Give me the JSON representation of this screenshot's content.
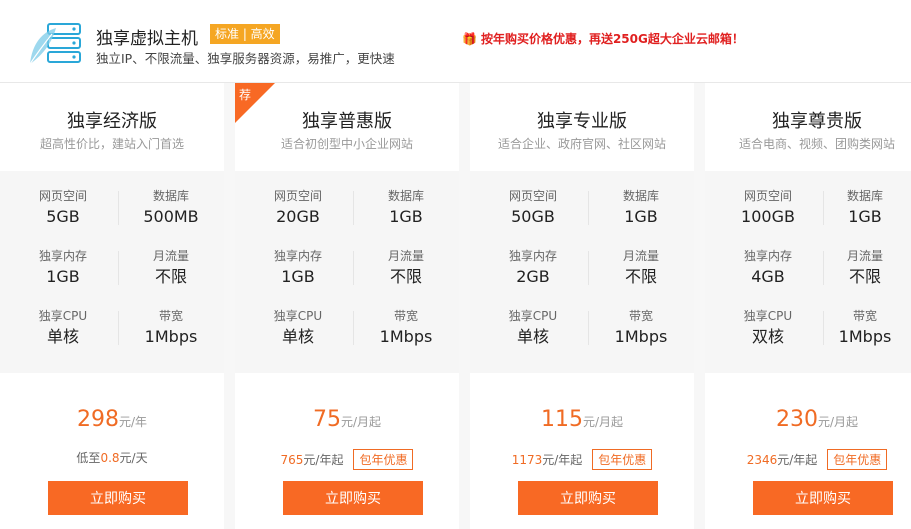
{
  "header": {
    "title": "独享虚拟主机",
    "tags": "标准 | 高效",
    "subtitle": "独立IP、不限流量、独享服务器资源，易推广，更快速",
    "promo": "按年购买价格优惠，再送250G超大企业云邮箱！"
  },
  "colors": {
    "accent": "#f86924",
    "tag": "#f5a623",
    "promo": "#e02020"
  },
  "icons": {
    "logo": "server-leaf-icon",
    "promo": "gift-icon",
    "ribbon": "recommend-ribbon"
  },
  "ribbon_label": "荐",
  "spec_labels": [
    "网页空间",
    "数据库",
    "独享内存",
    "月流量",
    "独享CPU",
    "带宽"
  ],
  "plans": [
    {
      "name": "独享经济版",
      "desc": "超高性价比，建站入门首选",
      "specs": [
        "5GB",
        "500MB",
        "1GB",
        "不限",
        "单核",
        "1Mbps"
      ],
      "price": "298",
      "unit": "元/年",
      "sub_prefix": "低至",
      "sub_value": "0.8",
      "sub_suffix": "元/天",
      "buy_label": "立即购买"
    },
    {
      "name": "独享普惠版",
      "desc": "适合初创型中小企业网站",
      "specs": [
        "20GB",
        "1GB",
        "1GB",
        "不限",
        "单核",
        "1Mbps"
      ],
      "price": "75",
      "unit": "元/月起",
      "sub_value": "765",
      "sub_suffix": "元/年起",
      "badge": "包年优惠",
      "buy_label": "立即购买"
    },
    {
      "name": "独享专业版",
      "desc": "适合企业、政府官网、社区网站",
      "specs": [
        "50GB",
        "1GB",
        "2GB",
        "不限",
        "单核",
        "1Mbps"
      ],
      "price": "115",
      "unit": "元/月起",
      "sub_value": "1173",
      "sub_suffix": "元/年起",
      "badge": "包年优惠",
      "buy_label": "立即购买"
    },
    {
      "name": "独享尊贵版",
      "desc": "适合电商、视频、团购类网站",
      "specs": [
        "100GB",
        "1GB",
        "4GB",
        "不限",
        "双核",
        "1Mbps"
      ],
      "price": "230",
      "unit": "元/月起",
      "sub_value": "2346",
      "sub_suffix": "元/年起",
      "badge": "包年优惠",
      "buy_label": "立即购买"
    }
  ]
}
